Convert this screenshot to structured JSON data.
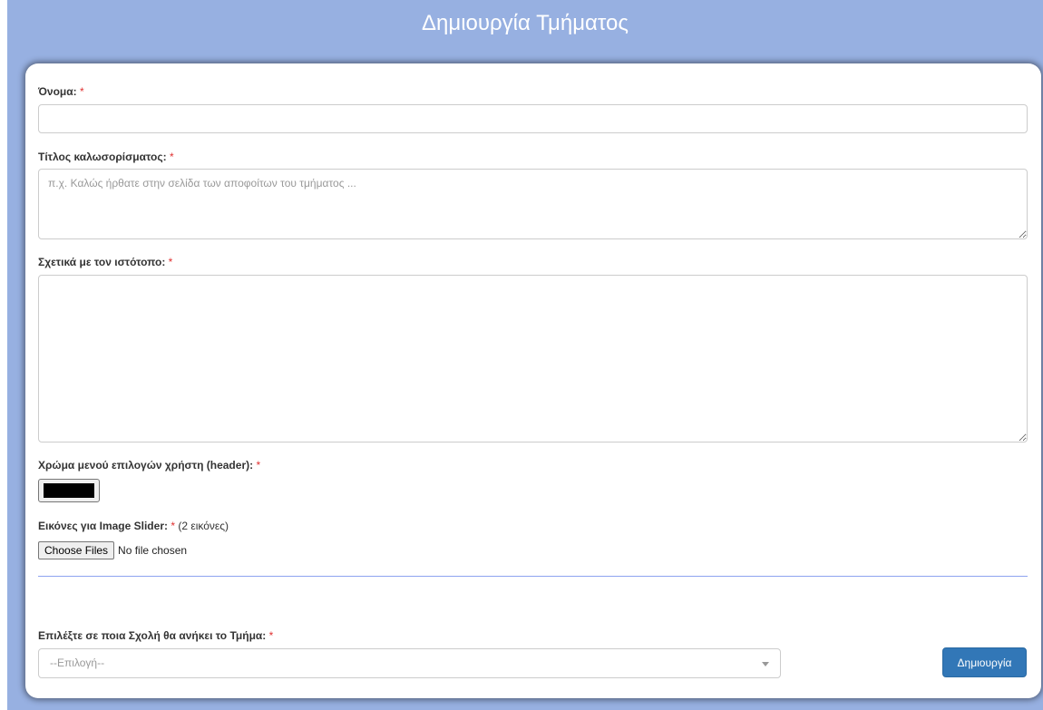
{
  "header": {
    "title": "Δημιουργία Τμήματος"
  },
  "required_marker": "*",
  "form": {
    "name": {
      "label": "Όνομα:",
      "value": ""
    },
    "welcome_title": {
      "label": "Τίτλος καλωσορίσματος:",
      "placeholder": "π.χ. Καλώς ήρθατε στην σελίδα των αποφοίτων του τμήματος ...",
      "value": ""
    },
    "about": {
      "label": "Σχετικά με τον ιστότοπο:",
      "value": ""
    },
    "header_color": {
      "label": "Χρώμα μενού επιλογών χρήστη (header):",
      "value": "#000000"
    },
    "slider_images": {
      "label": "Εικόνες για Image Slider:",
      "note": "(2 εικόνες)",
      "button_label": "Choose Files",
      "status": "No file chosen"
    },
    "school": {
      "label": "Επιλέξτε σε ποια Σχολή θα ανήκει το Τμήμα:",
      "selected": "--Επιλογή--"
    },
    "submit_label": "Δημιουργία"
  },
  "colors": {
    "banner": "#97b0e1",
    "primary_button": "#3277b7",
    "required": "#e03131",
    "divider": "#8ea3f0"
  }
}
